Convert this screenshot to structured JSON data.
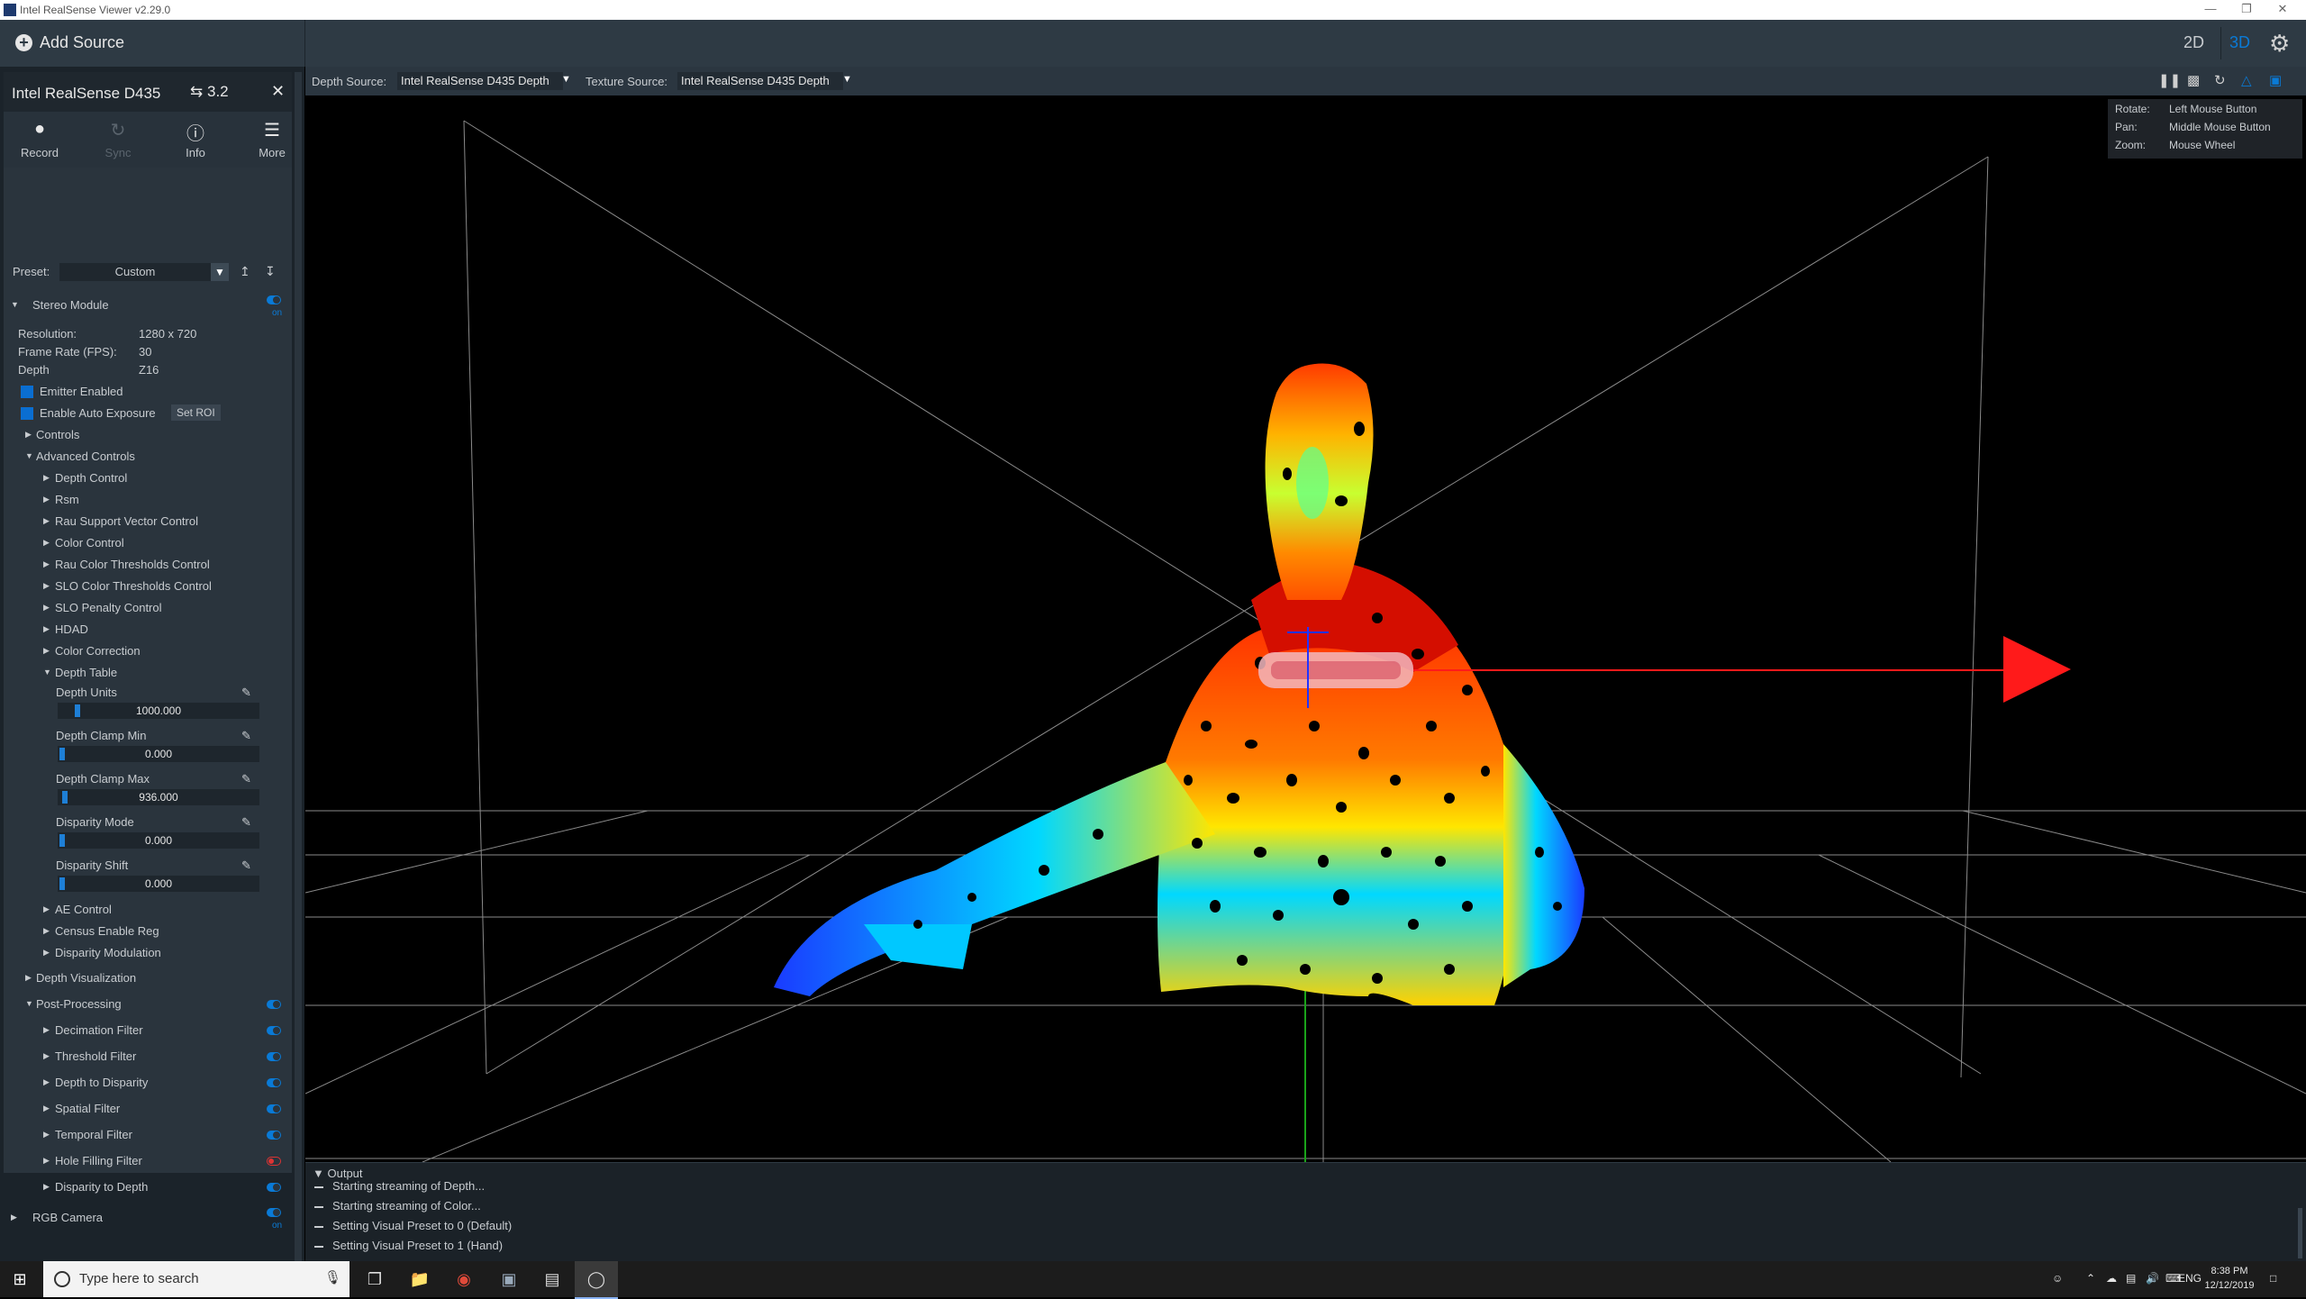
{
  "window": {
    "title": "Intel RealSense Viewer v2.29.0"
  },
  "topbar": {
    "add_source": "Add Source",
    "mode_2d": "2D",
    "mode_3d": "3D",
    "active_mode": "3D",
    "accent_color": "#0a7ad6"
  },
  "device": {
    "name": "Intel RealSense D435",
    "usb": "3.2",
    "actions": {
      "record": "Record",
      "sync": "Sync",
      "info": "Info",
      "more": "More"
    },
    "preset_label": "Preset:",
    "preset_value": "Custom",
    "stereo_module": {
      "label": "Stereo Module",
      "on_label": "on",
      "resolution_label": "Resolution:",
      "resolution_value": "1280 x 720",
      "fps_label": "Frame Rate (FPS):",
      "fps_value": "30",
      "depth_label": "Depth",
      "depth_value": "Z16",
      "emitter_enabled": "Emitter Enabled",
      "auto_exposure": "Enable Auto Exposure",
      "set_roi": "Set ROI",
      "controls": "Controls",
      "advanced_controls": "Advanced Controls",
      "advanced_items": [
        "Depth Control",
        "Rsm",
        "Rau Support Vector Control",
        "Color Control",
        "Rau Color Thresholds Control",
        "SLO Color Thresholds Control",
        "SLO Penalty Control",
        "HDAD",
        "Color Correction",
        "Depth Table"
      ],
      "depth_table": [
        {
          "label": "Depth Units",
          "value": "1000.000",
          "level": 0.07
        },
        {
          "label": "Depth Clamp Min",
          "value": "0.000",
          "level": 0.0
        },
        {
          "label": "Depth Clamp Max",
          "value": "936.000",
          "level": 0.02
        },
        {
          "label": "Disparity Mode",
          "value": "0.000",
          "level": 0.0
        },
        {
          "label": "Disparity Shift",
          "value": "0.000",
          "level": 0.0
        }
      ],
      "after_items": [
        "AE Control",
        "Census Enable Reg",
        "Disparity Modulation"
      ],
      "depth_visualization": "Depth Visualization",
      "post_processing": "Post-Processing",
      "filters": [
        {
          "label": "Decimation Filter",
          "enabled": true
        },
        {
          "label": "Threshold Filter",
          "enabled": true
        },
        {
          "label": "Depth to Disparity",
          "enabled": true
        },
        {
          "label": "Spatial Filter",
          "enabled": true
        },
        {
          "label": "Temporal Filter",
          "enabled": true
        },
        {
          "label": "Hole Filling Filter",
          "enabled": false
        },
        {
          "label": "Disparity to Depth",
          "enabled": true
        }
      ]
    },
    "rgb_camera": {
      "label": "RGB Camera",
      "on_label": "on"
    }
  },
  "viewport": {
    "depth_source_label": "Depth Source:",
    "depth_source_value": "Intel RealSense D435 Depth",
    "texture_source_label": "Texture Source:",
    "texture_source_value": "Intel RealSense D435 Depth",
    "controls_help": [
      {
        "key": "Rotate:",
        "value": "Left Mouse Button"
      },
      {
        "key": "Pan:",
        "value": "Middle Mouse Button"
      },
      {
        "key": "Zoom:",
        "value": "Mouse Wheel"
      }
    ]
  },
  "output": {
    "header": "Output",
    "logs": [
      "Starting streaming of Depth...",
      "Starting streaming of Color...",
      "Setting Visual Preset to 0 (Default)",
      "Setting Visual Preset to 1 (Hand)"
    ]
  },
  "taskbar": {
    "search_placeholder": "Type here to search",
    "lang": "ENG",
    "time": "8:38 PM",
    "date": "12/12/2019"
  }
}
